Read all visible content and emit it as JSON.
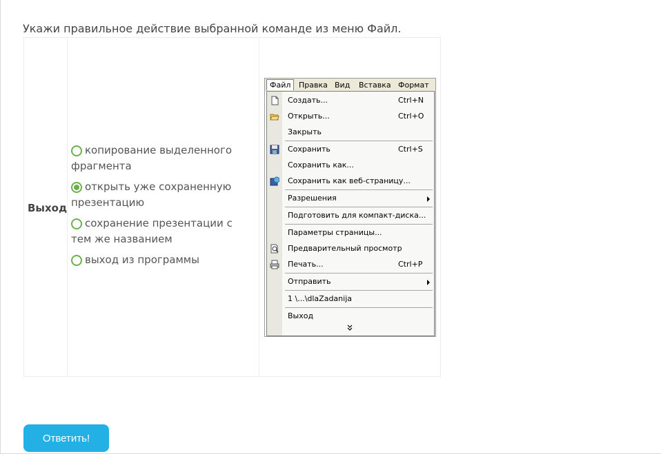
{
  "question": "Укажи правильное действие выбранной команде из меню Файл.",
  "term": "Выход",
  "answers": [
    {
      "label": "копирование выделенного фрагмента",
      "checked": false
    },
    {
      "label": "открыть уже сохраненную презентацию",
      "checked": true
    },
    {
      "label": "сохранение презентации с тем же названием",
      "checked": false
    },
    {
      "label": "выход из программы",
      "checked": false
    }
  ],
  "menu_image": {
    "menubar": [
      "Файл",
      "Правка",
      "Вид",
      "Вставка",
      "Формат"
    ],
    "items": [
      {
        "label": "Создать...",
        "shortcut": "Ctrl+N",
        "icon": "new-document-icon"
      },
      {
        "label": "Открыть...",
        "shortcut": "Ctrl+O",
        "icon": "open-folder-icon"
      },
      {
        "label": "Закрыть",
        "shortcut": "",
        "icon": ""
      },
      {
        "label": "Сохранить",
        "shortcut": "Ctrl+S",
        "icon": "save-disk-icon"
      },
      {
        "label": "Сохранить как...",
        "shortcut": "",
        "icon": ""
      },
      {
        "label": "Сохранить как веб-страницу...",
        "shortcut": "",
        "icon": "save-web-icon"
      },
      {
        "label": "Разрешения",
        "shortcut": "",
        "icon": ""
      },
      {
        "label": "Подготовить для компакт-диска...",
        "shortcut": "",
        "icon": ""
      },
      {
        "label": "Параметры страницы...",
        "shortcut": "",
        "icon": ""
      },
      {
        "label": "Предварительный просмотр",
        "shortcut": "",
        "icon": "print-preview-icon"
      },
      {
        "label": "Печать...",
        "shortcut": "Ctrl+P",
        "icon": "printer-icon"
      },
      {
        "label": "Отправить",
        "shortcut": "",
        "icon": ""
      },
      {
        "label": "1 \\...\\dlaZadanija",
        "shortcut": "",
        "icon": ""
      },
      {
        "label": "Выход",
        "shortcut": "",
        "icon": ""
      }
    ]
  },
  "submit_label": "Ответить!",
  "colors": {
    "accent": "#23b1e5",
    "radio": "#6ab04c"
  }
}
